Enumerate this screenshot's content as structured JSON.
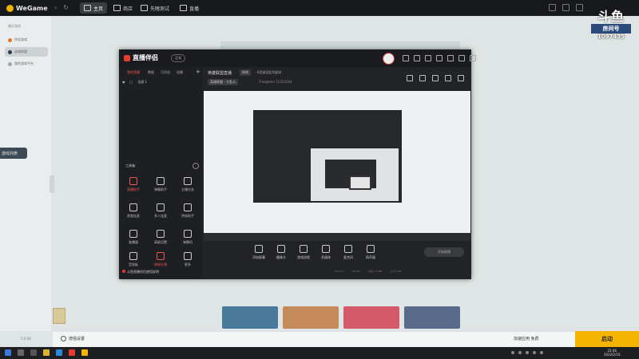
{
  "wegame": {
    "app_name": "WeGame",
    "tabs": [
      {
        "label": "主页"
      },
      {
        "label": "商店"
      },
      {
        "label": "先睹测试"
      },
      {
        "label": "直播"
      }
    ],
    "sidebar": {
      "header": "最近游戏",
      "items": [
        {
          "label": "传奇游戏"
        },
        {
          "label": "英雄联盟"
        },
        {
          "label": "我的游戏平台"
        }
      ],
      "tooltip": "游戏列表",
      "version": "5.0.93"
    },
    "bottom": {
      "update_label": "增强设置",
      "accel_label": "加速应用 免费",
      "launch_label": "启动"
    }
  },
  "watermark": {
    "line1": "斗鱼",
    "line2": "房间号",
    "line3": "1097435"
  },
  "live_app": {
    "title": "直播伴侣",
    "version": "正式",
    "left_tabs": [
      {
        "label": "我的直播"
      },
      {
        "label": "数据"
      },
      {
        "label": "可用也"
      },
      {
        "label": "组播"
      }
    ],
    "scene_label": "全屏 1",
    "tools_header": "工具箱",
    "tools": [
      {
        "label": "直播助手"
      },
      {
        "label": "弹幕助手"
      },
      {
        "label": "主播任务"
      },
      {
        "label": "视频连麦"
      },
      {
        "label": "多人连麦"
      },
      {
        "label": "特效助手"
      },
      {
        "label": "鉴播器"
      },
      {
        "label": "高级设置"
      },
      {
        "label": "弹幕机"
      },
      {
        "label": "音效板"
      },
      {
        "label": "神秘礼物"
      },
      {
        "label": "更多"
      }
    ],
    "tip": "斗鱼直播伴侣使用说明",
    "room": {
      "title": "英雄联盟直播",
      "tag": "修改",
      "subtitle": "K西部战区的副本",
      "category": "英雄联盟 - 大乱斗",
      "id_label": "Freegame",
      "id_value": "11323584"
    },
    "toolbar": [
      {
        "label": "添加屏幕"
      },
      {
        "label": "摄像头"
      },
      {
        "label": "游戏进程"
      },
      {
        "label": "多媒体"
      },
      {
        "label": "麦克风"
      },
      {
        "label": "扬声器"
      }
    ],
    "start_label": "开始直播",
    "stats": [
      "CPU 0%",
      "FPS 60",
      "内存 0.0 MB",
      "上行 0 KB"
    ]
  },
  "taskbar": {
    "time": "22:46",
    "date": "2022/2/16"
  },
  "colors": {
    "accent_yellow": "#f4b400",
    "live_red": "#e63c2e"
  }
}
